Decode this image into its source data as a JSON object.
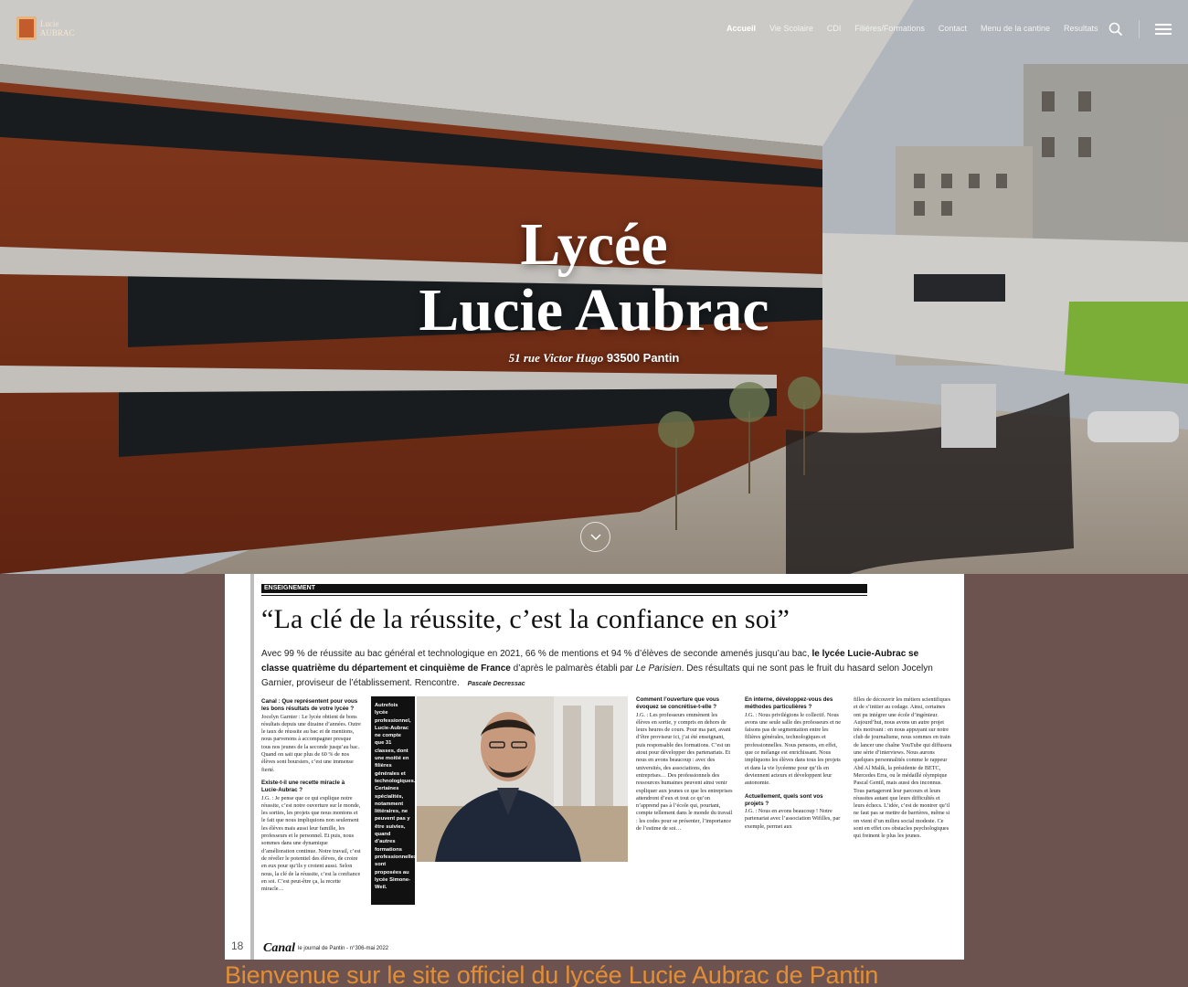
{
  "site": {
    "logo_text": "Lucie AUBRAC"
  },
  "nav": {
    "items": [
      {
        "label": "Accueil",
        "active": true
      },
      {
        "label": "Vie Scolaire"
      },
      {
        "label": "CDI"
      },
      {
        "label": "Filières/Formations"
      },
      {
        "label": "Contact"
      },
      {
        "label": "Menu de la cantine"
      },
      {
        "label": "Resultats"
      }
    ],
    "search_icon": "search-icon",
    "menu_icon": "hamburger-menu-icon"
  },
  "hero": {
    "title_line1": "Lycée",
    "title_line2": "Lucie Aubrac",
    "address_street": "51 rue Victor Hugo",
    "address_city": "93500 Pantin",
    "scroll_icon": "chevron-down-icon"
  },
  "article": {
    "rubric": "ENSEIGNEMENT",
    "headline": "“La clé de la réussite, c’est la confiance en soi”",
    "chapo_start": "Avec 99 % de réussite au bac général et technologique en 2021, 66 % de mentions et 94 % d’élèves de seconde amenés jusqu’au bac,",
    "chapo_bold": "le lycée Lucie-Aubrac se classe quatrième du département et cinquième de France",
    "chapo_mid": "d’après le palmarès établi par",
    "chapo_source": "Le Parisien",
    "chapo_end": ". Des résultats qui ne sont pas le fruit du hasard selon Jocelyn Garnier, proviseur de l’établissement. Rencontre.",
    "signature": "Pascale Decressac",
    "col1": [
      {
        "q": "Canal : Que représentent pour vous les bons résultats de votre lycée ?",
        "a": "Jocelyn Garnier : Le lycée obtient de bons résultats depuis une dizaine d’années. Outre le taux de réussite au bac et de mentions, nous parvenons à accompagner presque tous nos jeunes de la seconde jusqu’au bac. Quand on sait que plus de 60 % de nos élèves sont boursiers, c’est une immense fierté."
      },
      {
        "q": "Existe-t-il une recette miracle à Lucie-Aubrac ?",
        "a": "J.G. : Je pense que ce qui explique notre réussite, c’est notre ouverture sur le monde, les sorties, les projets que nous montons et le fait que nous impliquions non seulement les élèves mais aussi leur famille, les professeurs et le personnel. Et puis, nous sommes dans une dynamique d’amélioration continue. Notre travail, c’est de révéler le potentiel des élèves, de croire en eux pour qu’ils y croient aussi. Selon nous, la clé de la réussite, c’est la confiance en soi. C’est peut-être ça, la recette miracle…"
      }
    ],
    "sidebar": "Autrefois lycée professionnel, Lucie-Aubrac ne compte que 31 classes, dont une moitié en filières générales et technologiques. Certaines spécialités, notamment littéraires, ne peuvent pas y être suivies, quand d’autres formations professionnelles sont proposées au lycée Simone-Weil.",
    "col3": [
      {
        "q": "Comment l’ouverture que vous évoquez se concrétise-t-elle ?",
        "a": "J.G. : Les professeurs emmènent les élèves en sortie, y compris en dehors de leurs heures de cours. Pour ma part, avant d’être proviseur ici, j’ai été enseignant, puis responsable des formations. C’est un atout pour développer des partenariats. Et nous en avons beaucoup : avec des universités, des associations, des entreprises… Des professionnels des ressources humaines peuvent ainsi venir expliquer aux jeunes ce que les entreprises attendront d’eux et tout ce qu’on n’apprend pas à l’école qui, pourtant, compte tellement dans le monde du travail : les codes pour se présenter, l’importance de l’estime de soi…"
      }
    ],
    "col4": [
      {
        "q": "En interne, développez-vous des méthodes particulières ?",
        "a": "J.G. : Nous privilégions le collectif. Nous avons une seule salle des professeurs et ne faisons pas de segmentation entre les filières générales, technologiques et professionnelles. Nous pensons, en effet, que ce mélange est enrichissant. Nous impliquons les élèves dans tous les projets et dans la vie lycéenne pour qu’ils en deviennent acteurs et développent leur autonomie."
      },
      {
        "q": "Actuellement, quels sont vos projets ?",
        "a": "J.G. : Nous en avons beaucoup ! Notre partenariat avec l’association Wifilles, par exemple, permet aux"
      }
    ],
    "col5": "filles de découvrir les métiers scientifiques et de s’initier au codage. Ainsi, certaines ont pu intégrer une école d’ingénieur. Aujourd’hui, nous avons un autre projet très motivant : en nous appuyant sur notre club de journalisme, nous sommes en train de lancer une chaîne YouTube qui diffusera une série d’interviews. Nous aurons quelques personnalités comme le rappeur Abd Al Malik, la présidente de BETC, Mercedes Erra, ou le médaillé olympique Pascal Gentil, mais aussi des inconnus. Tous partageront leur parcours et leurs réussites autant que leurs difficultés et leurs échecs. L’idée, c’est de montrer qu’il ne faut pas se mettre de barrières, même si on vient d’un milieu social modeste. Ce sont en effet ces obstacles psychologiques qui freinent le plus les jeunes.",
    "page_number": "18",
    "footer_brand": "Canal",
    "footer_text": "le journal de Pantin - n°306-mai 2022"
  },
  "welcome": "Bienvenue sur le site officiel du lycée Lucie Aubrac de Pantin",
  "colors": {
    "page_bg": "#6d5350",
    "welcome_text": "#e38e35",
    "facade_red": "#8e3a1f"
  }
}
